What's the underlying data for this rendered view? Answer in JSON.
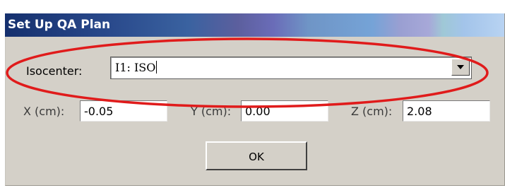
{
  "window": {
    "title": "Set Up QA Plan"
  },
  "isocenter": {
    "label": "Isocenter:",
    "value": "I1: ISO"
  },
  "coords": {
    "x": {
      "label": "X (cm):",
      "value": "-0.05"
    },
    "y": {
      "label": "Y (cm):",
      "value": "0.00"
    },
    "z": {
      "label": "Z (cm):",
      "value": "2.08"
    }
  },
  "buttons": {
    "ok": "OK"
  },
  "icons": {
    "dropdown": "chevron-down-icon"
  },
  "colors": {
    "annotation": "#e01b1b",
    "dialog_bg": "#d4d0c8"
  }
}
